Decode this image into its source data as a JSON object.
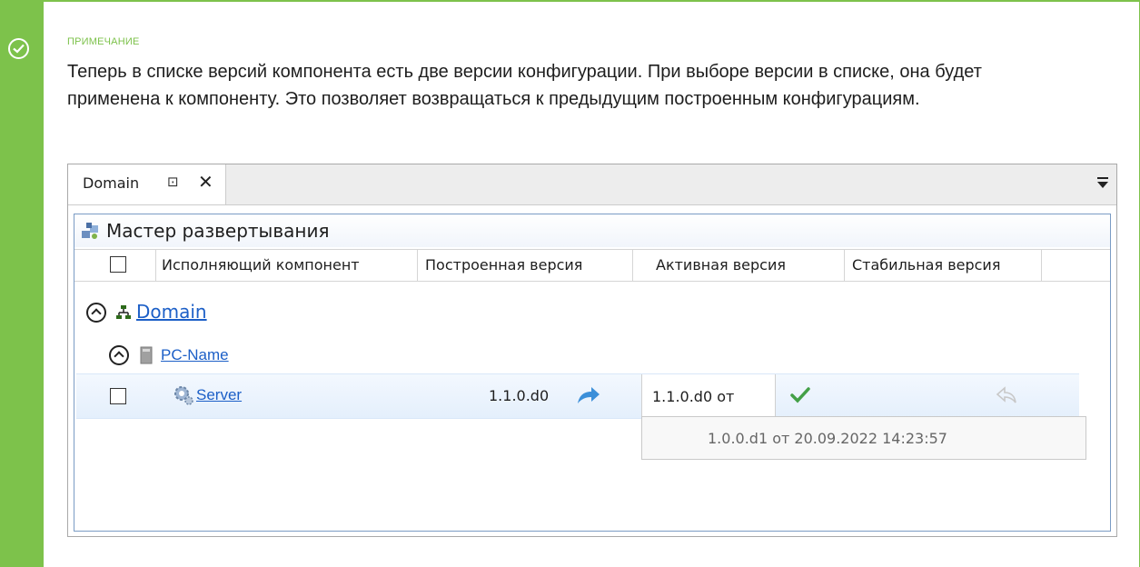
{
  "note": {
    "label": "ПРИМЕЧАНИЕ",
    "text": "Теперь в списке версий компонента есть две версии конфигурации. При выборе версии в списке, она будет применена к компоненту. Это позволяет возвращаться к предыдущим построенным конфигурациям.",
    "accent_color": "#7dc24b",
    "icon": "check-circle-icon"
  },
  "window": {
    "tab": {
      "title": "Domain",
      "pin_icon": "pin-icon",
      "close_icon": "close-icon"
    },
    "overflow_icon": "tab-overflow-icon"
  },
  "panel": {
    "title": "Мастер развертывания",
    "icon": "deployment-wizard-icon"
  },
  "grid": {
    "columns": [
      "Исполняющий компонент",
      "Построенная версия",
      "Активная версия",
      "Стабильная версия"
    ],
    "tree": {
      "domain": {
        "label": "Domain",
        "icon": "network-icon",
        "expanded": true
      },
      "pc": {
        "label": "PC-Name",
        "icon": "computer-icon",
        "expanded": true
      },
      "server": {
        "label": "Server",
        "icon": "gear-icon",
        "built_version": "1.1.0.d0",
        "active_version": "1.1.0.d0 от",
        "checked": false
      }
    },
    "dropdown_options": [
      "1.0.0.d1 от 20.09.2022 14:23:57"
    ]
  }
}
